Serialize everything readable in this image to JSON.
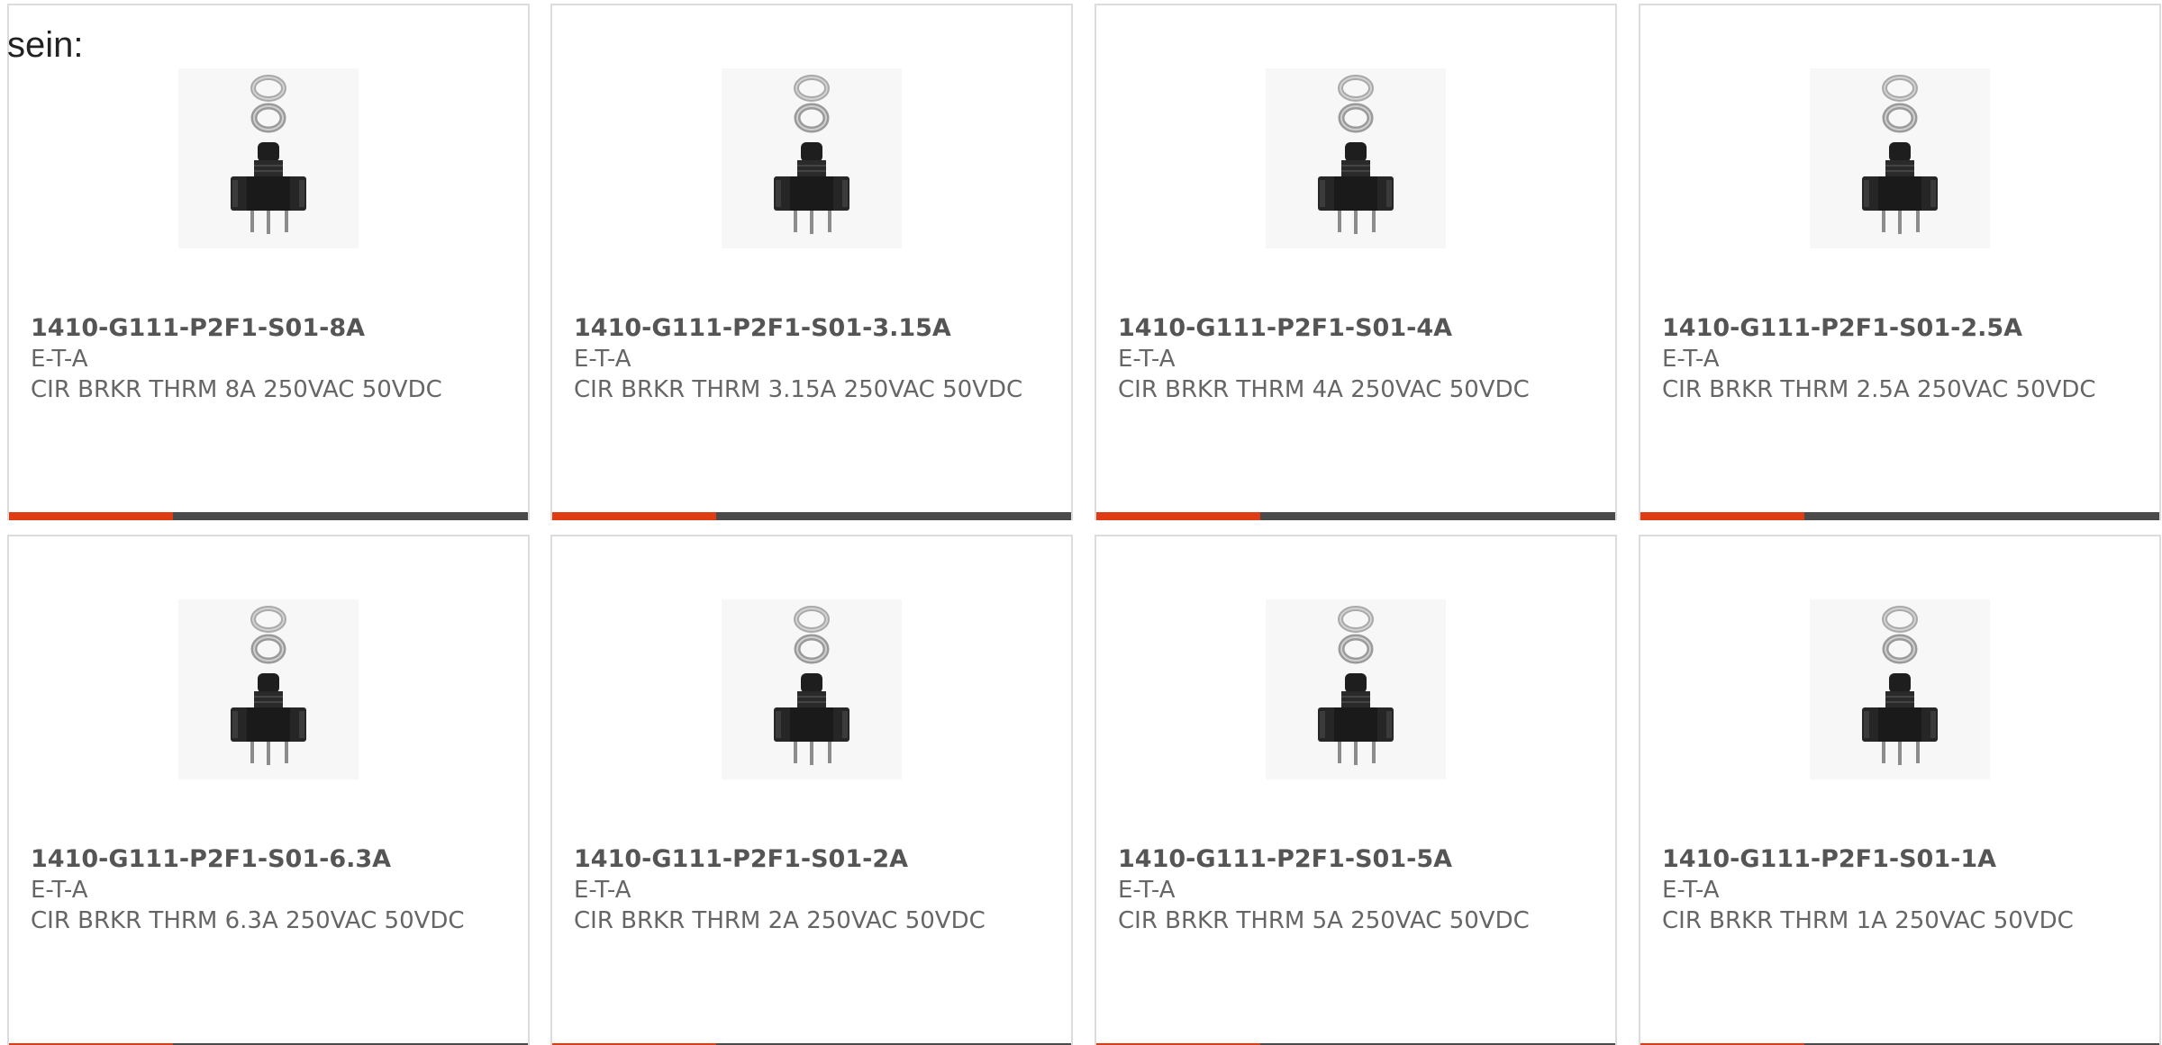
{
  "intro_text": "sein:",
  "colors": {
    "accent": "#e03c14",
    "bar": "#4a4a4a",
    "border": "#dcdcdc",
    "text": "#666666",
    "title": "#555555"
  },
  "products": [
    {
      "part_number": "1410-G111-P2F1-S01-8A",
      "manufacturer": "E-T-A",
      "description": "CIR BRKR THRM 8A 250VAC 50VDC",
      "image_icon": "circuit-breaker-image"
    },
    {
      "part_number": "1410-G111-P2F1-S01-3.15A",
      "manufacturer": "E-T-A",
      "description": "CIR BRKR THRM 3.15A 250VAC 50VDC",
      "image_icon": "circuit-breaker-image"
    },
    {
      "part_number": "1410-G111-P2F1-S01-4A",
      "manufacturer": "E-T-A",
      "description": "CIR BRKR THRM 4A 250VAC 50VDC",
      "image_icon": "circuit-breaker-image"
    },
    {
      "part_number": "1410-G111-P2F1-S01-2.5A",
      "manufacturer": "E-T-A",
      "description": "CIR BRKR THRM 2.5A 250VAC 50VDC",
      "image_icon": "circuit-breaker-image"
    },
    {
      "part_number": "1410-G111-P2F1-S01-6.3A",
      "manufacturer": "E-T-A",
      "description": "CIR BRKR THRM 6.3A 250VAC 50VDC",
      "image_icon": "circuit-breaker-image"
    },
    {
      "part_number": "1410-G111-P2F1-S01-2A",
      "manufacturer": "E-T-A",
      "description": "CIR BRKR THRM 2A 250VAC 50VDC",
      "image_icon": "circuit-breaker-image"
    },
    {
      "part_number": "1410-G111-P2F1-S01-5A",
      "manufacturer": "E-T-A",
      "description": "CIR BRKR THRM 5A 250VAC 50VDC",
      "image_icon": "circuit-breaker-image"
    },
    {
      "part_number": "1410-G111-P2F1-S01-1A",
      "manufacturer": "E-T-A",
      "description": "CIR BRKR THRM 1A 250VAC 50VDC",
      "image_icon": "circuit-breaker-image"
    }
  ]
}
